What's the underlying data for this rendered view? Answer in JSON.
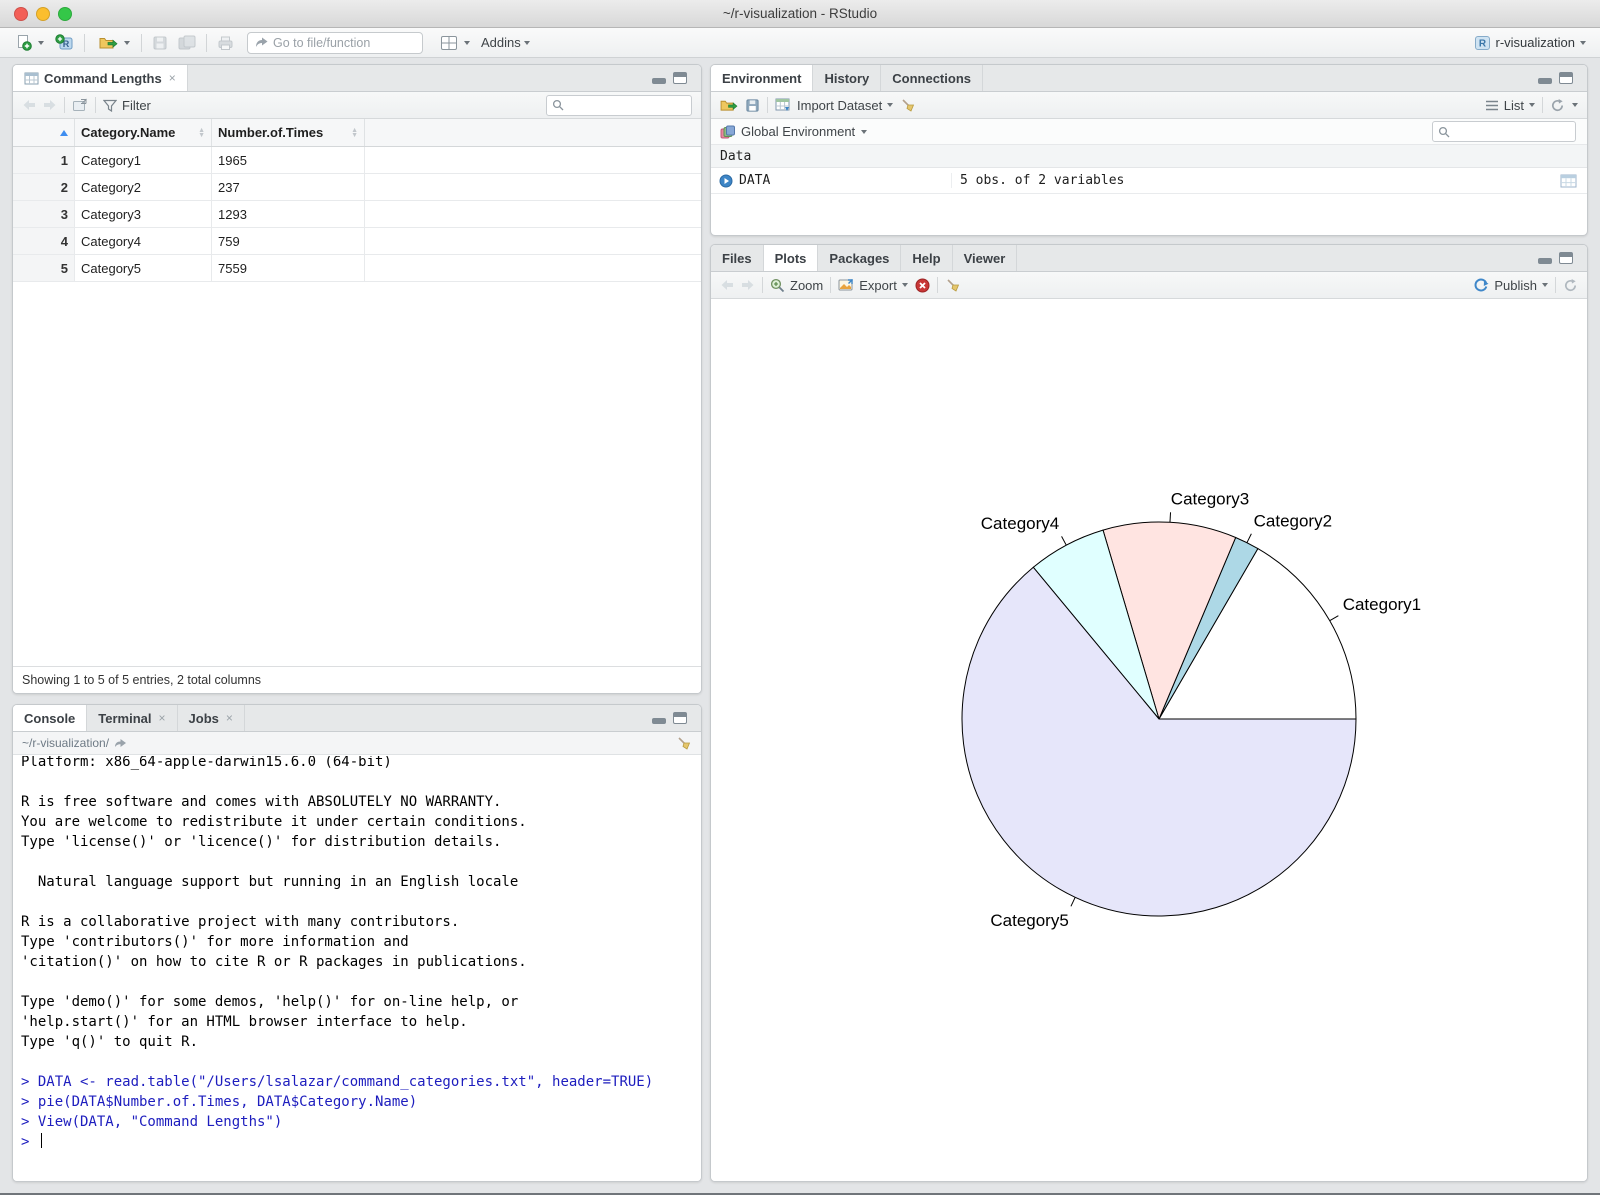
{
  "window": {
    "title": "~/r-visualization - RStudio"
  },
  "ui": {
    "close_glyph": "×"
  },
  "toolbar": {
    "goto_placeholder": "Go to file/function",
    "addins_label": "Addins",
    "project_label": "r-visualization"
  },
  "data_viewer": {
    "tab_title": "Command Lengths",
    "filter_label": "Filter",
    "columns": [
      "Category.Name",
      "Number.of.Times"
    ],
    "rows": [
      {
        "num": "1",
        "name": "Category1",
        "times": "1965"
      },
      {
        "num": "2",
        "name": "Category2",
        "times": "237"
      },
      {
        "num": "3",
        "name": "Category3",
        "times": "1293"
      },
      {
        "num": "4",
        "name": "Category4",
        "times": "759"
      },
      {
        "num": "5",
        "name": "Category5",
        "times": "7559"
      }
    ],
    "status": "Showing 1 to 5 of 5 entries, 2 total columns"
  },
  "environment": {
    "tabs": [
      "Environment",
      "History",
      "Connections"
    ],
    "import_label": "Import Dataset",
    "list_label": "List",
    "scope_label": "Global Environment",
    "section_label": "Data",
    "object_name": "DATA",
    "object_value": "5 obs. of 2 variables"
  },
  "plots": {
    "tabs": [
      "Files",
      "Plots",
      "Packages",
      "Help",
      "Viewer"
    ],
    "zoom_label": "Zoom",
    "export_label": "Export",
    "publish_label": "Publish"
  },
  "console": {
    "tabs": [
      "Console",
      "Terminal",
      "Jobs"
    ],
    "working_dir": "~/r-visualization/",
    "prompt": ">",
    "lines": [
      {
        "type": "out",
        "text": "Platform: x86_64-apple-darwin15.6.0 (64-bit)"
      },
      {
        "type": "out",
        "text": ""
      },
      {
        "type": "out",
        "text": "R is free software and comes with ABSOLUTELY NO WARRANTY."
      },
      {
        "type": "out",
        "text": "You are welcome to redistribute it under certain conditions."
      },
      {
        "type": "out",
        "text": "Type 'license()' or 'licence()' for distribution details."
      },
      {
        "type": "out",
        "text": ""
      },
      {
        "type": "out",
        "text": "  Natural language support but running in an English locale"
      },
      {
        "type": "out",
        "text": ""
      },
      {
        "type": "out",
        "text": "R is a collaborative project with many contributors."
      },
      {
        "type": "out",
        "text": "Type 'contributors()' for more information and"
      },
      {
        "type": "out",
        "text": "'citation()' on how to cite R or R packages in publications."
      },
      {
        "type": "out",
        "text": ""
      },
      {
        "type": "out",
        "text": "Type 'demo()' for some demos, 'help()' for on-line help, or"
      },
      {
        "type": "out",
        "text": "'help.start()' for an HTML browser interface to help."
      },
      {
        "type": "out",
        "text": "Type 'q()' to quit R."
      },
      {
        "type": "out",
        "text": ""
      },
      {
        "type": "in",
        "text": "> DATA <- read.table(\"/Users/lsalazar/command_categories.txt\", header=TRUE)"
      },
      {
        "type": "in",
        "text": "> pie(DATA$Number.of.Times, DATA$Category.Name)"
      },
      {
        "type": "in",
        "text": "> View(DATA, \"Command Lengths\")"
      }
    ]
  },
  "chart_data": {
    "type": "pie",
    "title": "",
    "categories": [
      "Category1",
      "Category2",
      "Category3",
      "Category4",
      "Category5"
    ],
    "values": [
      1965,
      237,
      1293,
      759,
      7559
    ],
    "total": 11813,
    "colors": [
      "#FFFFFF",
      "#ADD8E6",
      "#FFE4E1",
      "#E0FFFF",
      "#E6E6FA"
    ],
    "start_angle_deg": 0,
    "direction": "counterclockwise",
    "labels_position": "outside",
    "legend_position": "none"
  }
}
